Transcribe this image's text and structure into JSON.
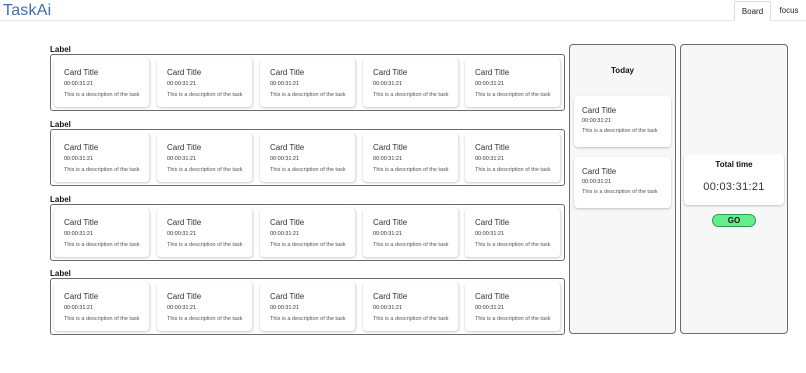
{
  "app": {
    "logo": "TaskAi"
  },
  "nav": {
    "tabs": [
      {
        "label": "Board"
      },
      {
        "label": "focus"
      }
    ]
  },
  "board": {
    "groups": [
      {
        "label": "Label",
        "cards": [
          {
            "title": "Card Title",
            "time": "00:00:31:21",
            "description": "This is a description of the task"
          },
          {
            "title": "Card Title",
            "time": "00:00:31:21",
            "description": "This is a description of the task"
          },
          {
            "title": "Card Title",
            "time": "00:00:31:21",
            "description": "This is a description of the task"
          },
          {
            "title": "Card Title",
            "time": "00:00:31:21",
            "description": "This is a description of the task"
          },
          {
            "title": "Card Title",
            "time": "00:00:31:21",
            "description": "This is a description of the task"
          }
        ]
      },
      {
        "label": "Label",
        "cards": [
          {
            "title": "Card Title",
            "time": "00:00:31:21",
            "description": "This is a description of the task"
          },
          {
            "title": "Card Title",
            "time": "00:00:31:21",
            "description": "This is a description of the task"
          },
          {
            "title": "Card Title",
            "time": "00:00:31:21",
            "description": "This is a description of the task"
          },
          {
            "title": "Card Title",
            "time": "00:00:31:21",
            "description": "This is a description of the task"
          },
          {
            "title": "Card Title",
            "time": "00:00:31:21",
            "description": "This is a description of the task"
          }
        ]
      },
      {
        "label": "Label",
        "cards": [
          {
            "title": "Card Title",
            "time": "00:00:31:21",
            "description": "This is a description of the task"
          },
          {
            "title": "Card Title",
            "time": "00:00:31:21",
            "description": "This is a description of the task"
          },
          {
            "title": "Card Title",
            "time": "00:00:31:21",
            "description": "This is a description of the task"
          },
          {
            "title": "Card Title",
            "time": "00:00:31:21",
            "description": "This is a description of the task"
          },
          {
            "title": "Card Title",
            "time": "00:00:31:21",
            "description": "This is a description of the task"
          }
        ]
      },
      {
        "label": "Label",
        "cards": [
          {
            "title": "Card Title",
            "time": "00:00:31:21",
            "description": "This is a description of the task"
          },
          {
            "title": "Card Title",
            "time": "00:00:31:21",
            "description": "This is a description of the task"
          },
          {
            "title": "Card Title",
            "time": "00:00:31:21",
            "description": "This is a description of the task"
          },
          {
            "title": "Card Title",
            "time": "00:00:31:21",
            "description": "This is a description of the task"
          },
          {
            "title": "Card Title",
            "time": "00:00:31:21",
            "description": "This is a description of the task"
          }
        ]
      }
    ]
  },
  "today": {
    "title": "Today",
    "cards": [
      {
        "title": "Card Title",
        "time": "00:00:31:21",
        "description": "This is a description of the task"
      },
      {
        "title": "Card Title",
        "time": "00:00:31:21",
        "description": "This is a description of the task"
      }
    ]
  },
  "summary": {
    "label": "Total time",
    "value": "00:03:31:21",
    "go_label": "GO"
  },
  "colors": {
    "brand": "#3f6fa8",
    "go_button": "#66ee8e",
    "panel_bg": "#f7f7f8"
  }
}
